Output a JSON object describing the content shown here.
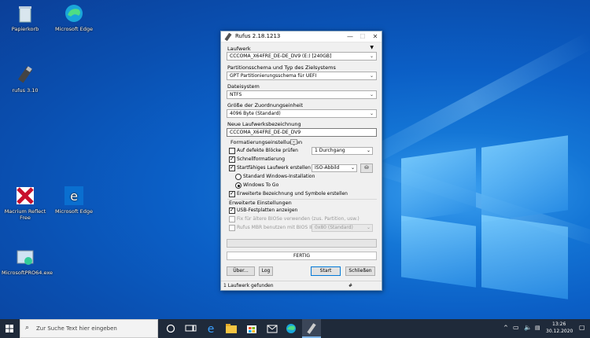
{
  "desktop": {
    "icons": [
      {
        "label": "Papierkorb"
      },
      {
        "label": "Microsoft Edge"
      },
      {
        "label": "rufus 3.10"
      },
      {
        "label": "Macrium Reflect Free"
      },
      {
        "label": "Microsoft Edge"
      },
      {
        "label": "MicrosoftPRO64.exe"
      }
    ]
  },
  "window": {
    "title": "Rufus 2.18.1213",
    "drive_label": "Laufwerk",
    "drive_value": "CCCOMA_X64FRE_DE-DE_DV9 (E:) [240GB]",
    "partition_label": "Partitionsschema und Typ des Zielsystems",
    "partition_value": "GPT Partitionierungsschema für UEFI",
    "fs_label": "Dateisystem",
    "fs_value": "NTFS",
    "cluster_label": "Größe der Zuordnungseinheit",
    "cluster_value": "4096 Byte (Standard)",
    "volume_label": "Neue Laufwerksbezeichnung",
    "volume_value": "CCCOMA_X64FRE_DE-DE_DV9",
    "format_group": "Formatierungseinstellungen",
    "bad_blocks": "Auf defekte Blöcke prüfen",
    "passes_value": "1 Durchgang",
    "quick_format": "Schnellformatierung",
    "bootable": "Startfähiges Laufwerk erstellen mit",
    "iso_value": "ISO-Abbild",
    "std_install": "Standard Windows-Installation",
    "win_to_go": "Windows To Go",
    "extended_label": "Erweiterte Bezeichnung und Symbole erstellen",
    "advanced_group": "Erweiterte Einstellungen",
    "usb_hdd": "USB-Festplatten anzeigen",
    "fix_bios": "Fix für ältere BIOSe verwenden (zus. Partition, usw.)",
    "rufus_mbr": "Rufus MBR benutzen mit BIOS ID",
    "bios_id_value": "0x80 (Standard)",
    "status_text": "FERTIG",
    "about_btn": "Über...",
    "log_btn": "Log",
    "start_btn": "Start",
    "close_btn": "Schließen",
    "statusbar_text": "1 Laufwerk gefunden",
    "statusbar_hash": "#"
  },
  "taskbar": {
    "search_placeholder": "Zur Suche Text hier eingeben",
    "time": "13:26",
    "date": "30.12.2020"
  },
  "colors": {
    "accent": "#0078d7",
    "taskbar": "#1f2a3a"
  }
}
